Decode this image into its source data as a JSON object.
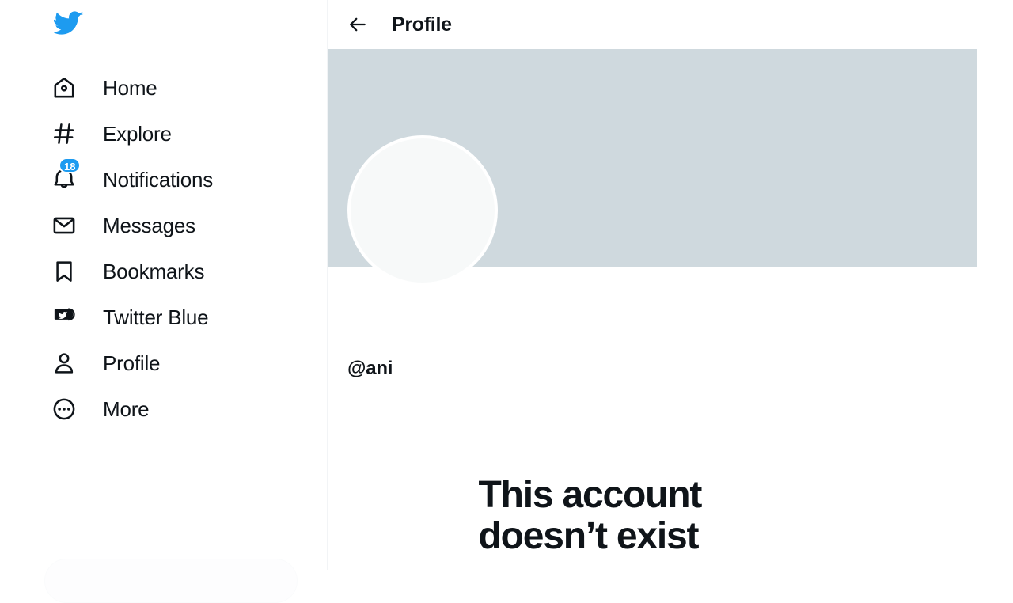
{
  "brand": {
    "logo_icon": "twitter-bird-icon",
    "accent_color": "#1d9bf0",
    "text_color": "#0f1419",
    "banner_color": "#cfd9de",
    "avatar_color": "#f7f9f9"
  },
  "sidebar": {
    "items": [
      {
        "label": "Home",
        "icon": "home-icon",
        "badge": null
      },
      {
        "label": "Explore",
        "icon": "hashtag-icon",
        "badge": null
      },
      {
        "label": "Notifications",
        "icon": "bell-icon",
        "badge": "18"
      },
      {
        "label": "Messages",
        "icon": "envelope-icon",
        "badge": null
      },
      {
        "label": "Bookmarks",
        "icon": "bookmark-icon",
        "badge": null
      },
      {
        "label": "Twitter Blue",
        "icon": "twitter-blue-badge-icon",
        "badge": null
      },
      {
        "label": "Profile",
        "icon": "person-icon",
        "badge": null
      },
      {
        "label": "More",
        "icon": "more-circle-icon",
        "badge": null
      }
    ]
  },
  "header": {
    "back_icon": "arrow-left-icon",
    "title": "Profile"
  },
  "profile": {
    "handle": "@ani"
  },
  "empty_state": {
    "title": "This account doesn’t exist"
  }
}
